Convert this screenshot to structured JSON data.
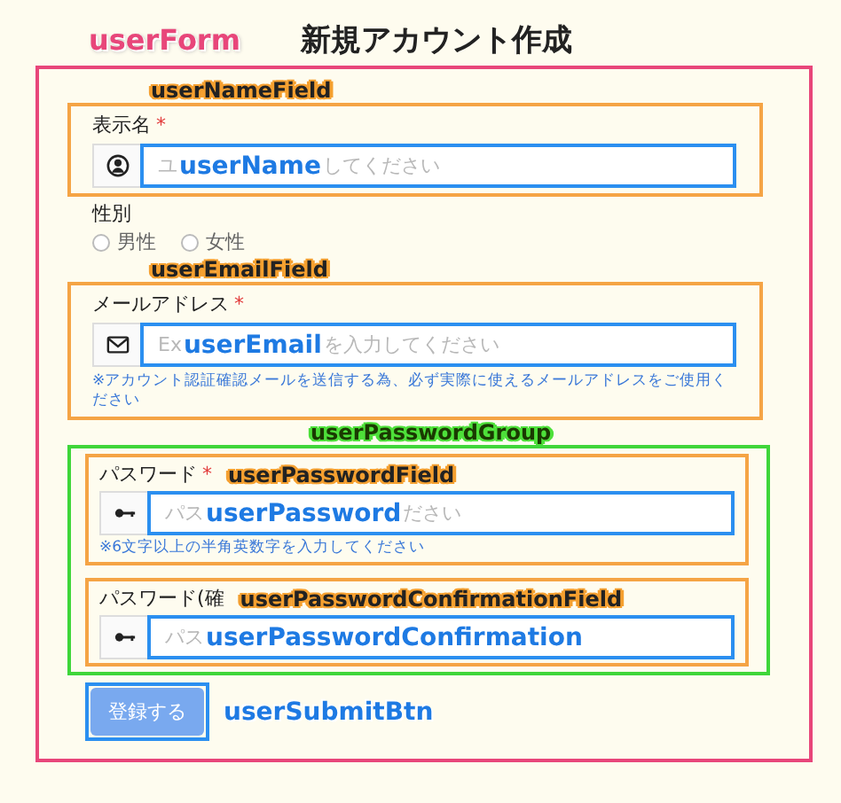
{
  "header": {
    "tag": {
      "kind": "form",
      "text": "userForm"
    },
    "title": "新規アカウント作成"
  },
  "sections": [
    {
      "kind": "text",
      "tag": {
        "kind": "field",
        "text": "userNameField"
      },
      "label": "表示名",
      "mark": "*",
      "input": {
        "tag": {
          "kind": "control",
          "text": "userName"
        },
        "placeholder_parts": [
          "ユ",
          "してください"
        ]
      }
    },
    {
      "kind": "radio",
      "label": "性別",
      "options": [
        {
          "label": "男性",
          "selected": false
        },
        {
          "label": "女性",
          "selected": false
        }
      ]
    },
    {
      "kind": "email",
      "tag": {
        "kind": "field",
        "text": "userEmailField"
      },
      "label": "メールアドレス",
      "mark": "*",
      "input": {
        "tag": {
          "kind": "control",
          "text": "userEmail"
        },
        "placeholder_parts": [
          "Ex",
          "を入力してください"
        ]
      },
      "help": "※アカウント認証確認メールを送信する為、必ず実際に使えるメールアドレスをご使用ください"
    },
    {
      "kind": "group",
      "tag": {
        "kind": "group",
        "text": "userPasswordGroup"
      },
      "children": [
        {
          "kind": "password",
          "tag": {
            "kind": "field",
            "text": "userPasswordField"
          },
          "label": "パスワード",
          "mark": "*",
          "input": {
            "tag": {
              "kind": "control",
              "text": "userPassword"
            },
            "placeholder_parts": [
              "パス",
              "ださい"
            ]
          },
          "help": "※6文字以上の半角英数字を入力してください"
        },
        {
          "kind": "password",
          "tag": {
            "kind": "field",
            "text": "userPasswordConfirmationField"
          },
          "label": "パスワード(確",
          "input": {
            "tag": {
              "kind": "control",
              "text": "userPasswordConfirmation"
            },
            "placeholder_parts": [
              "パス"
            ]
          }
        }
      ]
    },
    {
      "kind": "button",
      "label": "登録する",
      "disabled": true,
      "tag": {
        "kind": "control",
        "text": "userSubmitBtn"
      }
    }
  ]
}
